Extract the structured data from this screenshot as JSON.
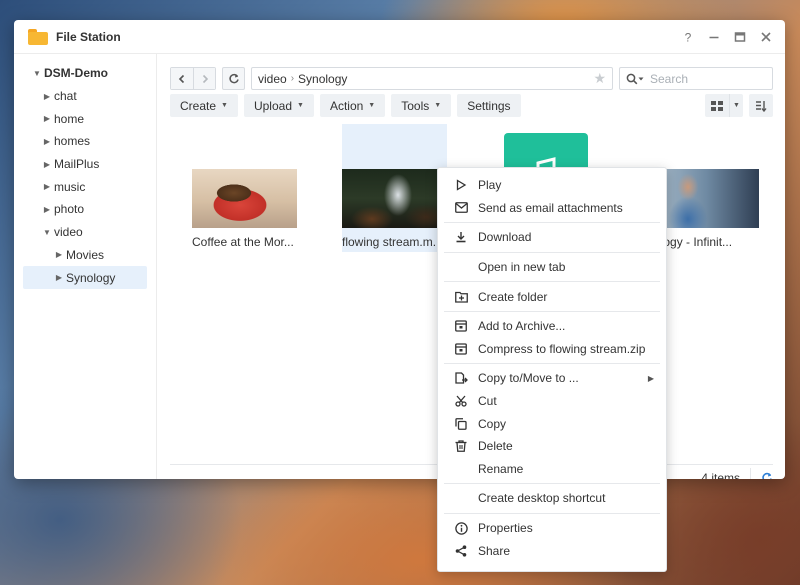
{
  "window": {
    "title": "File Station"
  },
  "window_controls": [
    "help-icon",
    "minimize-icon",
    "maximize-icon",
    "close-icon"
  ],
  "sidebar": {
    "root": "DSM-Demo",
    "items": [
      {
        "label": "chat"
      },
      {
        "label": "home"
      },
      {
        "label": "homes"
      },
      {
        "label": "MailPlus"
      },
      {
        "label": "music"
      },
      {
        "label": "photo"
      },
      {
        "label": "video"
      }
    ],
    "video_children": [
      {
        "label": "Movies"
      },
      {
        "label": "Synology"
      }
    ],
    "active": "Synology"
  },
  "path": {
    "segments": [
      "video",
      "Synology"
    ]
  },
  "search": {
    "placeholder": "Search"
  },
  "toolbar": {
    "create": "Create",
    "upload": "Upload",
    "action": "Action",
    "tools": "Tools",
    "settings": "Settings"
  },
  "files": [
    {
      "name": "Coffee at the Mor...",
      "thumb": "coffee"
    },
    {
      "name": "flowing stream.m...",
      "thumb": "stream",
      "selected": true
    },
    {
      "name": "",
      "thumb": "folder"
    },
    {
      "name": "ology - Infinit...",
      "thumb": "person"
    }
  ],
  "status": {
    "items": "4 items"
  },
  "context_menu": {
    "items": [
      {
        "label": "Play",
        "icon": "play-icon"
      },
      {
        "label": "Send as email attachments",
        "icon": "mail-icon"
      },
      {
        "label": "Download",
        "icon": "download-icon"
      },
      {
        "label": "Open in new tab",
        "icon": ""
      },
      {
        "label": "Create folder",
        "icon": "folder-plus-icon"
      },
      {
        "label": "Add to Archive...",
        "icon": "archive-icon"
      },
      {
        "label": "Compress to flowing stream.zip",
        "icon": "archive-icon"
      },
      {
        "label": "Copy to/Move to ...",
        "icon": "copy-move-icon",
        "submenu": true
      },
      {
        "label": "Cut",
        "icon": "scissors-icon"
      },
      {
        "label": "Copy",
        "icon": "copy-icon"
      },
      {
        "label": "Delete",
        "icon": "trash-icon"
      },
      {
        "label": "Rename",
        "icon": ""
      },
      {
        "label": "Create desktop shortcut",
        "icon": ""
      },
      {
        "label": "Properties",
        "icon": "info-icon"
      },
      {
        "label": "Share",
        "icon": "share-icon"
      }
    ]
  },
  "colors": {
    "accent": "#2f7fd6",
    "selection": "#e6f0fb",
    "folder": "#1fbf9a"
  }
}
